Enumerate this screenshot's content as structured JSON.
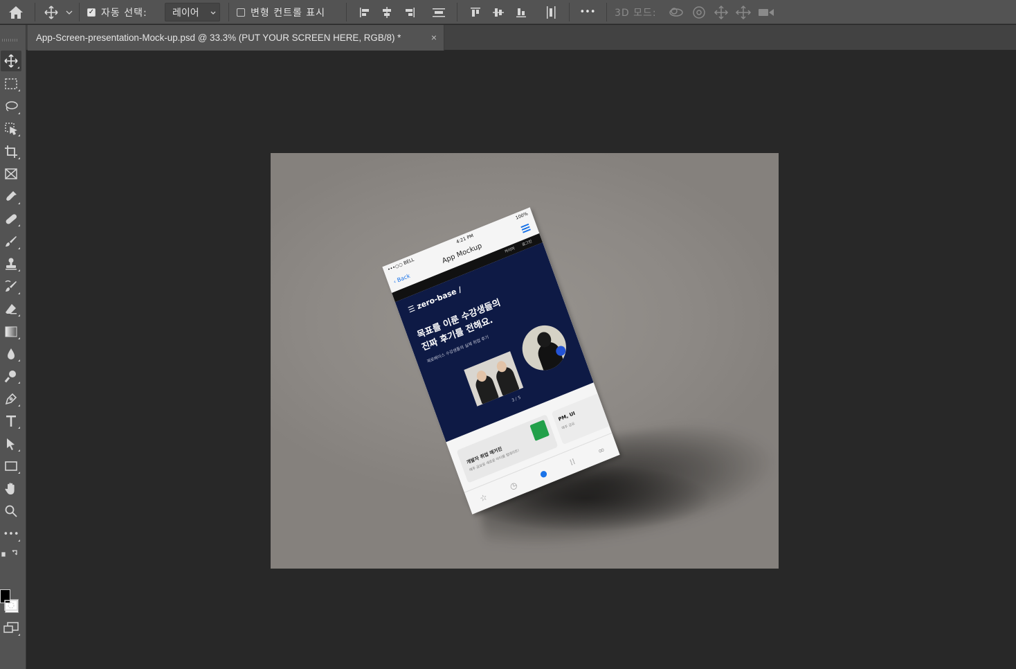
{
  "options_bar": {
    "auto_select_label": "자동 선택:",
    "auto_select_checked": true,
    "auto_select_target": "레이어",
    "transform_controls_label": "변형 컨트롤 표시",
    "transform_controls_checked": false,
    "more_label": "•••",
    "mode_3d_label": "3D 모드:"
  },
  "document_tab": {
    "title": "App-Screen-presentation-Mock-up.psd @ 33.3% (PUT YOUR SCREEN HERE, RGB/8) *",
    "close": "×"
  },
  "toolbar": {
    "more_label": "•••",
    "foreground_color": "#000000",
    "background_color": "#ffffff"
  },
  "mockup_screen": {
    "status_carrier": "•••○○ BELL",
    "status_time": "4:21 PM",
    "status_battery": "100%",
    "nav_back": "Back",
    "nav_title": "App Mockup",
    "top_links": "커리어 로그인",
    "logo": "zero-base /",
    "headline_line1": "목표를 이룬 수강생들의",
    "headline_line2": "진짜 후기를 전해요.",
    "subtext": "제로베이스 수강생들의 실제 취업 후기",
    "slide_counter": "3 / 5",
    "card_title": "개발자 취업 매거진",
    "card_sub": "매주 금요일 새로운 아티클 업데이트!",
    "card2_title": "PM, UI",
    "card2_sub": "매주 금요"
  },
  "colors": {
    "app_bg": "#282828",
    "panel": "#535353",
    "canvas_bg": "#918d89",
    "hero_navy": "#0e1a45",
    "accent_blue": "#1a73e8",
    "green": "#22a04a"
  }
}
